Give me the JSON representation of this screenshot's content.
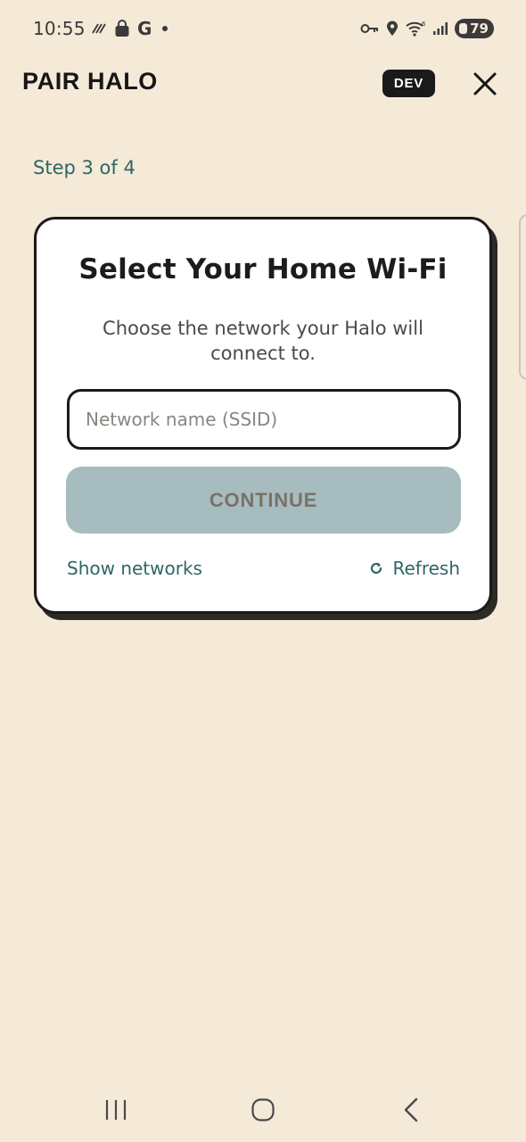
{
  "status_bar": {
    "time": "10:55",
    "carrier_letter": "G",
    "battery_level": "79",
    "left_icons": [
      "signal-activity-icon",
      "shopping-bag-icon",
      "google-icon",
      "notification-dot-icon"
    ],
    "right_icons": [
      "vpn-key-icon",
      "location-icon",
      "wifi-icon",
      "cellular-signal-icon",
      "battery-icon"
    ]
  },
  "header": {
    "title": "PAIR HALO",
    "badge": "DEV",
    "close_icon": "close-icon"
  },
  "step": {
    "label": "Step 3 of 4"
  },
  "card": {
    "title": "Select Your Home Wi-Fi",
    "subtitle": "Choose the network your Halo will connect to.",
    "ssid_input": {
      "value": "",
      "placeholder": "Network name (SSID)"
    },
    "continue_label": "CONTINUE",
    "show_networks_label": "Show networks",
    "refresh_label": "Refresh",
    "refresh_icon": "refresh-icon"
  },
  "nav_bar": {
    "icons": [
      "recent-apps-icon",
      "home-icon",
      "back-icon"
    ]
  },
  "colors": {
    "background": "#f5e9d8",
    "accent_teal": "#2f6667",
    "button_disabled": "#a6bcbf",
    "card_border": "#1a1a1a"
  }
}
